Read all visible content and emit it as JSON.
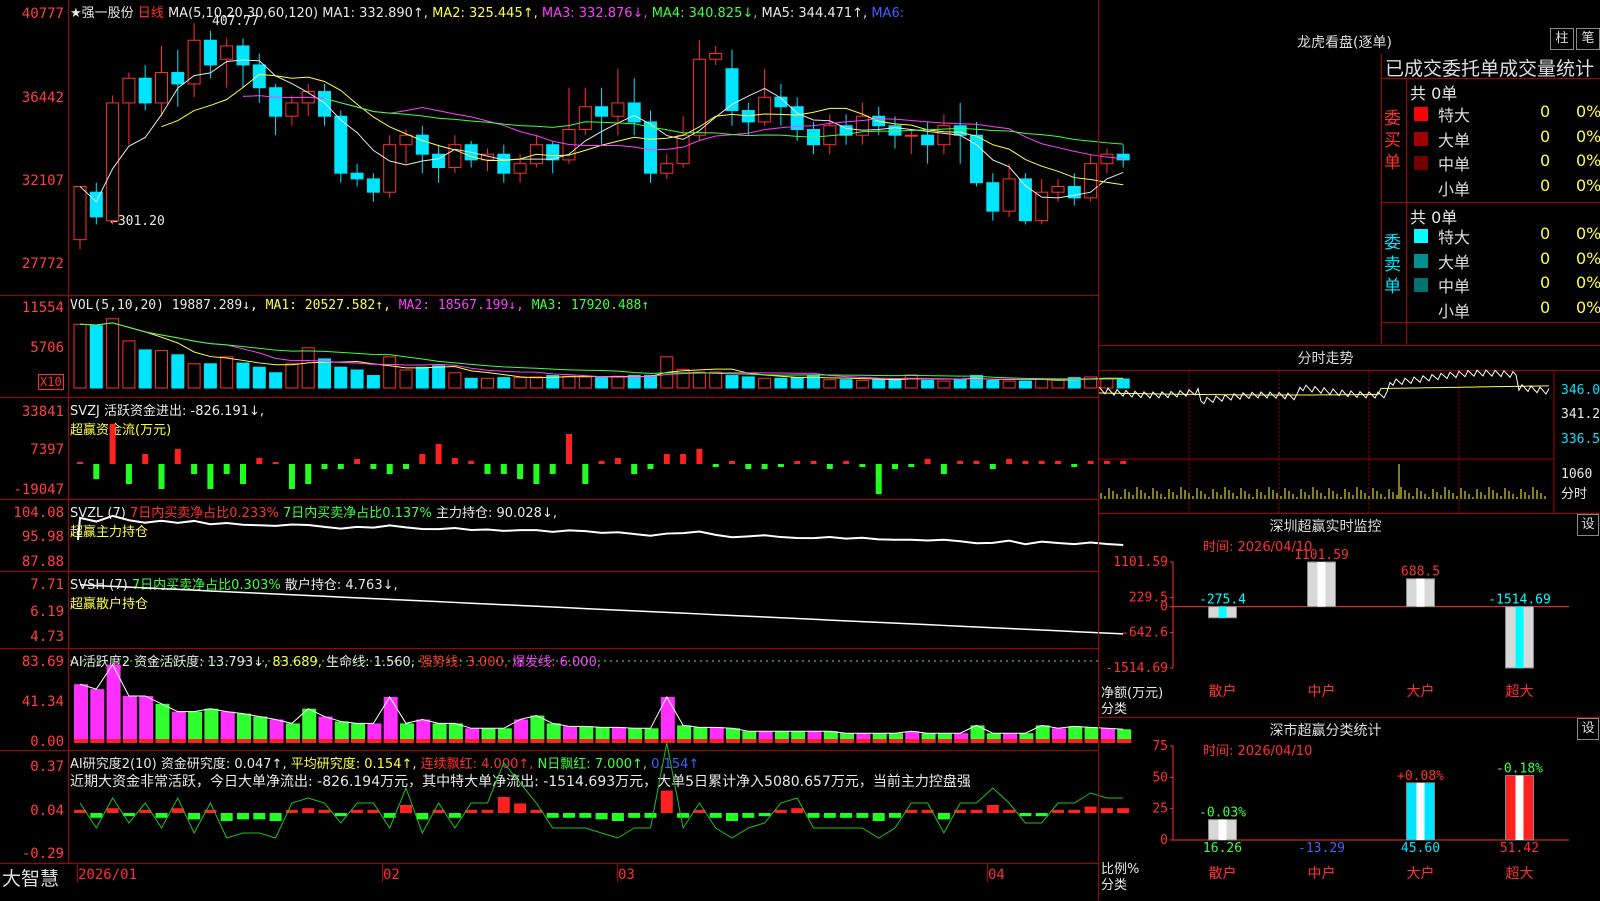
{
  "main_chart": {
    "stock_name": "★强一股份",
    "period": "日线",
    "ma_label": "MA(5,10,20,30,60,120)",
    "ma_values": [
      {
        "text": "MA1: 332.890↑,",
        "color": "#e8e8e8"
      },
      {
        "text": "MA2: 325.445↑,",
        "color": "#ffff40"
      },
      {
        "text": "MA3: 332.876↓,",
        "color": "#ff40ff"
      },
      {
        "text": "MA4: 340.825↓,",
        "color": "#40ff40"
      },
      {
        "text": "MA5: 344.471↑,",
        "color": "#e8e8e8"
      },
      {
        "text": "MA6:",
        "color": "#4060ff"
      }
    ],
    "y_ticks": [
      "40777",
      "36442",
      "32107",
      "27772"
    ],
    "high_mark": "407.77",
    "low_mark": "←301.20",
    "candles": [
      [
        290,
        318,
        285,
        315
      ],
      [
        315,
        302,
        298,
        320
      ],
      [
        300,
        362,
        298,
        366
      ],
      [
        362,
        375,
        340,
        378
      ],
      [
        375,
        362,
        358,
        382
      ],
      [
        362,
        378,
        355,
        392
      ],
      [
        378,
        372,
        360,
        390
      ],
      [
        372,
        395,
        365,
        404
      ],
      [
        395,
        382,
        375,
        400
      ],
      [
        385,
        392,
        370,
        396
      ],
      [
        392,
        382,
        370,
        396
      ],
      [
        382,
        370,
        362,
        388
      ],
      [
        370,
        355,
        345,
        372
      ],
      [
        355,
        362,
        350,
        366
      ],
      [
        362,
        368,
        355,
        372
      ],
      [
        368,
        355,
        350,
        372
      ],
      [
        355,
        325,
        320,
        358
      ],
      [
        325,
        322,
        318,
        330
      ],
      [
        322,
        315,
        310,
        325
      ],
      [
        315,
        340,
        312,
        345
      ],
      [
        340,
        345,
        330,
        348
      ],
      [
        345,
        335,
        325,
        350
      ],
      [
        335,
        328,
        320,
        340
      ],
      [
        328,
        340,
        325,
        345
      ],
      [
        340,
        332,
        328,
        342
      ],
      [
        332,
        335,
        326,
        338
      ],
      [
        335,
        325,
        320,
        340
      ],
      [
        325,
        330,
        320,
        335
      ],
      [
        330,
        340,
        328,
        345
      ],
      [
        340,
        332,
        325,
        342
      ],
      [
        332,
        348,
        330,
        370
      ],
      [
        348,
        360,
        345,
        370
      ],
      [
        360,
        355,
        340,
        370
      ],
      [
        355,
        362,
        345,
        380
      ],
      [
        362,
        352,
        345,
        375
      ],
      [
        352,
        325,
        320,
        358
      ],
      [
        325,
        330,
        322,
        335
      ],
      [
        330,
        345,
        328,
        355
      ],
      [
        345,
        385,
        342,
        395
      ],
      [
        385,
        388,
        382,
        392
      ],
      [
        380,
        358,
        350,
        390
      ],
      [
        358,
        352,
        345,
        362
      ],
      [
        352,
        365,
        350,
        380
      ],
      [
        365,
        360,
        350,
        372
      ],
      [
        360,
        348,
        342,
        365
      ],
      [
        348,
        340,
        335,
        352
      ],
      [
        340,
        350,
        335,
        356
      ],
      [
        350,
        345,
        340,
        356
      ],
      [
        345,
        355,
        340,
        362
      ],
      [
        355,
        350,
        345,
        360
      ],
      [
        350,
        345,
        338,
        355
      ],
      [
        345,
        345,
        335,
        348
      ],
      [
        345,
        340,
        330,
        352
      ],
      [
        340,
        350,
        335,
        356
      ],
      [
        350,
        345,
        330,
        362
      ],
      [
        345,
        320,
        318,
        352
      ],
      [
        320,
        305,
        300,
        325
      ],
      [
        305,
        322,
        302,
        330
      ],
      [
        322,
        300,
        298,
        325
      ],
      [
        300,
        315,
        298,
        322
      ],
      [
        315,
        318,
        310,
        322
      ],
      [
        318,
        312,
        308,
        325
      ],
      [
        312,
        330,
        310,
        335
      ],
      [
        330,
        335,
        325,
        338
      ],
      [
        335,
        332,
        328,
        340
      ]
    ]
  },
  "vol": {
    "title": "VOL(5,10,20)",
    "value": "19887.289↓,",
    "ma_values": [
      {
        "text": "MA1: 20527.582↑,",
        "color": "#ffff40"
      },
      {
        "text": "MA2: 18567.199↓,",
        "color": "#ff40ff"
      },
      {
        "text": "MA3: 17920.488↑",
        "color": "#40ff40"
      }
    ],
    "y_ticks": [
      "11554",
      "5706"
    ],
    "unit_badge": "X10",
    "bars": [
      9200,
      9000,
      10000,
      6800,
      5500,
      5400,
      4800,
      3500,
      3500,
      4500,
      3600,
      3000,
      2200,
      3500,
      5800,
      4200,
      3000,
      2600,
      1800,
      4500,
      2600,
      3000,
      3200,
      2200,
      1400,
      1400,
      1500,
      1500,
      1600,
      1800,
      1700,
      1600,
      1500,
      1700,
      1800,
      1800,
      4500,
      2700,
      2300,
      2300,
      1800,
      1600,
      1400,
      1400,
      1500,
      1800,
      1200,
      1200,
      1100,
      1200,
      1300,
      1900,
      1100,
      1000,
      1200,
      1800,
      1100,
      1000,
      1000,
      1300,
      1200,
      1500,
      1600,
      1400,
      1300
    ]
  },
  "svzj": {
    "title": "SVZJ",
    "label": "活跃资金进出: -826.191↓,",
    "subtitle": "超赢资金流(万元)",
    "y_ticks": [
      "33841",
      "7397",
      "-19047"
    ],
    "bars": [
      0,
      -1.5,
      4,
      -2,
      1,
      -2.5,
      1.5,
      -1,
      -2.5,
      -1,
      -2,
      0.6,
      0,
      -2.5,
      -2,
      -0.5,
      -0.5,
      0.5,
      -0.5,
      -1,
      -0.5,
      1,
      2,
      0.6,
      0.3,
      -1,
      -1,
      -1.5,
      -2,
      -1,
      3,
      -2,
      0.3,
      0.6,
      -1,
      -0.5,
      1,
      1,
      1.5,
      -0.3,
      0.3,
      -0.5,
      -0.5,
      -0.3,
      0.3,
      0.3,
      -0.5,
      0.3,
      -0.3,
      -3,
      -0.5,
      -0.3,
      0.5,
      -1,
      0.3,
      0.3,
      -0.5,
      0.5,
      0.3,
      0.3,
      0.3,
      -0.3,
      0.3,
      0.3,
      0.3
    ]
  },
  "svzl": {
    "title": "SVZL (7)",
    "label1": "7日内买卖净占比0.233%",
    "label2": "7日内买卖净占比0.137%",
    "label3": "主力持仓: 90.028↓,",
    "subtitle": "超赢主力持仓",
    "y_ticks": [
      "104.08",
      "95.98",
      "87.88"
    ]
  },
  "svsh": {
    "title": "SVSH (7)",
    "label1": "7日内买卖净占比0.303%",
    "label2": "散户持仓: 4.763↓,",
    "subtitle": "超赢散户持仓",
    "y_ticks": [
      "7.71",
      "6.19",
      "4.73"
    ]
  },
  "aihy": {
    "title": "AI活跃度2",
    "label1": "资金活跃度: 13.793↓,",
    "label2": "83.689,",
    "label3": "生命线: 1.560,",
    "label4": "强势线: 3.000,",
    "label5": "爆发线: 6.000,",
    "y_ticks": [
      "83.69",
      "41.34",
      "0.00"
    ],
    "bars": [
      60,
      55,
      80,
      48,
      48,
      40,
      32,
      32,
      35,
      32,
      30,
      27,
      24,
      20,
      35,
      27,
      22,
      20,
      20,
      47,
      20,
      24,
      20,
      20,
      15,
      15,
      15,
      24,
      28,
      20,
      17,
      17,
      16,
      16,
      15,
      15,
      47,
      18,
      16,
      16,
      15,
      12,
      12,
      12,
      12,
      12,
      12,
      10,
      10,
      10,
      10,
      12,
      10,
      10,
      10,
      18,
      10,
      10,
      10,
      18,
      15,
      17,
      16,
      15,
      14
    ]
  },
  "aiyj": {
    "title": "AI研究度2(10)",
    "label1": "资金研究度: 0.047↑,",
    "label2": "平均研究度: 0.154↑,",
    "label3": "连续飘红: 4.000↑,",
    "label4": "N日飘红: 7.000↑,",
    "label5": "0.154↑",
    "commentary": "近期大资金非常活跃，今日大单净流出: -826.194万元，其中特大单净流出: -1514.693万元，大单5日累计净入5080.657万元，当前主力控盘强",
    "y_ticks": [
      "0.37",
      "0.04",
      "-0.29"
    ],
    "bars": [
      0.02,
      -0.03,
      0.03,
      -0.02,
      0.02,
      -0.03,
      0.03,
      -0.04,
      0.02,
      -0.05,
      -0.04,
      -0.04,
      -0.05,
      0.02,
      0.03,
      0.02,
      -0.02,
      0.02,
      0.02,
      -0.03,
      0.05,
      -0.04,
      0.02,
      -0.03,
      0.02,
      0.02,
      0.1,
      0.06,
      0.02,
      -0.03,
      -0.03,
      -0.03,
      -0.04,
      -0.05,
      -0.03,
      -0.03,
      0.14,
      -0.03,
      0.02,
      -0.03,
      -0.05,
      -0.03,
      -0.02,
      0.02,
      0.03,
      -0.03,
      -0.03,
      -0.03,
      -0.03,
      -0.05,
      -0.03,
      0.02,
      0.02,
      -0.04,
      0.02,
      0.02,
      0.05,
      0.02,
      -0.02,
      -0.02,
      0.02,
      0.02,
      0.04,
      0.03,
      0.03
    ]
  },
  "date_axis": {
    "labels": [
      "2026/01",
      "02",
      "03",
      "04"
    ],
    "app_name": "大智慧"
  },
  "lhb": {
    "title": "龙虎看盘(逐单)",
    "btn_zhu": "柱",
    "btn_bi": "笔",
    "header": "已成交委托单成交量统计",
    "buy_label": "委买单",
    "sell_label": "委卖单",
    "buy_total": "共 0单",
    "sell_total": "共 0单",
    "buy_rows": [
      {
        "name": "特大",
        "count": "0",
        "pct": "0%",
        "color": "#ff0000"
      },
      {
        "name": "大单",
        "count": "0",
        "pct": "0%",
        "color": "#a00000"
      },
      {
        "name": "中单",
        "count": "0",
        "pct": "0%",
        "color": "#700000"
      },
      {
        "name": "小单",
        "count": "0",
        "pct": "0%",
        "color": "#000000"
      }
    ],
    "sell_rows": [
      {
        "name": "特大",
        "count": "0",
        "pct": "0%",
        "color": "#00ffff"
      },
      {
        "name": "大单",
        "count": "0",
        "pct": "0%",
        "color": "#009090"
      },
      {
        "name": "中单",
        "count": "0",
        "pct": "0%",
        "color": "#007070"
      },
      {
        "name": "小单",
        "count": "0",
        "pct": "0%",
        "color": "#000000"
      }
    ]
  },
  "intraday": {
    "title": "分时走势",
    "y_ticks": [
      "346.0",
      "341.2",
      "336.5"
    ],
    "vol_tick": "1060",
    "vol_label": "分时"
  },
  "monitor": {
    "title": "深圳超赢实时监控",
    "btn": "设",
    "time_label": "时间: 2026/04/10",
    "y_ticks": [
      "1101.59",
      "229.5",
      "0",
      "-642.6",
      "-1514.69"
    ],
    "ylabel": "净额(万元)",
    "xlabel": "分类",
    "chart_data": {
      "type": "bar",
      "categories": [
        "散户",
        "中户",
        "大户",
        "超大"
      ],
      "values": [
        -275.4,
        1101.59,
        688.5,
        -1514.69
      ],
      "value_labels": [
        "-275.4",
        "1101.59",
        "688.5",
        "-1514.69"
      ],
      "ylim": [
        -1514.69,
        1101.59
      ]
    }
  },
  "classify": {
    "title": "深市超赢分类统计",
    "btn": "设",
    "time_label": "时间: 2026/04/10",
    "y_ticks": [
      "75",
      "50",
      "25",
      "0"
    ],
    "ylabel": "比例%",
    "xlabel": "分类",
    "chart_data": {
      "type": "bar",
      "categories": [
        "散户",
        "中户",
        "大户",
        "超大"
      ],
      "values": [
        16.26,
        -13.29,
        45.6,
        51.42
      ],
      "value_labels": [
        "16.26",
        "-13.29",
        "45.60",
        "51.42"
      ],
      "change_labels": [
        "-0.03%",
        "",
        "+0.08%",
        "-0.18%"
      ],
      "ylim": [
        0,
        75
      ]
    }
  }
}
